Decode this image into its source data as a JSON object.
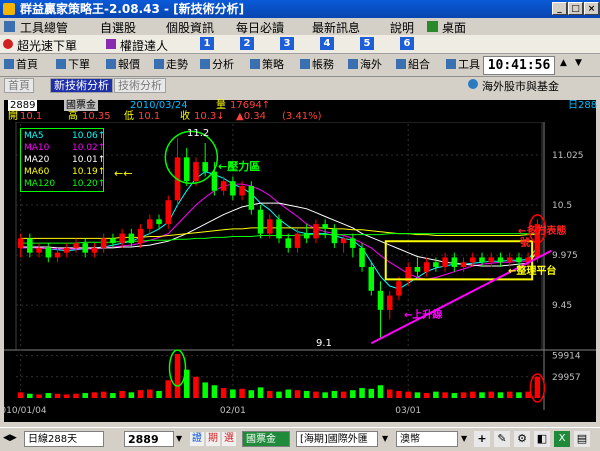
{
  "window": {
    "title": "群益贏家策略王-2.08.43 - [新技術分析]"
  },
  "menu": {
    "items": [
      "工具總管",
      "自選股",
      "個股資訊",
      "每日必讀",
      "最新訊息",
      "說明",
      "桌面"
    ]
  },
  "quickbar": {
    "items": [
      "超光速下單",
      "權證達人"
    ],
    "numbers": [
      "1",
      "2",
      "3",
      "4",
      "5",
      "6"
    ]
  },
  "toolbar": {
    "items": [
      "首頁",
      "下單",
      "報價",
      "走勢",
      "分析",
      "策略",
      "帳務",
      "海外",
      "組合",
      "工具"
    ],
    "clock": "10:41:56"
  },
  "tabs": {
    "items": [
      "首頁",
      "新技術分析",
      "技術分析"
    ],
    "right_link": "海外股市與基金"
  },
  "info": {
    "code": "2889",
    "name": "國票金",
    "date": "2010/03/24",
    "volume_label": "量",
    "volume": "17694↑",
    "open_label": "開",
    "open": "10.1",
    "high_label": "高",
    "high": "10.35",
    "low_label": "低",
    "low": "10.1",
    "close_label": "收",
    "close": "10.3↓",
    "change": "▲0.34",
    "change_pct": "(3.41%)",
    "right_label": "日288"
  },
  "ma_legend": [
    {
      "name": "MA5",
      "value": "10.06↑",
      "color": "#00ffff"
    },
    {
      "name": "MA10",
      "value": "10.02↑",
      "color": "#ff00ff"
    },
    {
      "name": "MA20",
      "value": "10.01↑",
      "color": "#ffffff"
    },
    {
      "name": "MA60",
      "value": "10.19↑",
      "color": "#ffff00"
    },
    {
      "name": "MA120",
      "value": "10.20↑",
      "color": "#00ff00"
    }
  ],
  "annotations": {
    "resistance": "←壓力區",
    "bull_pattern": "←多方表態",
    "bull_pattern_tail": "號",
    "consolidation": "←整理平台",
    "uptrend": "←上升線",
    "left_arrow": "←←",
    "peak_label": "11.2",
    "low_label": "9.1"
  },
  "chart_data": {
    "type": "candlestick",
    "price_axis_ticks": [
      "11.025",
      "10.5",
      "9.975",
      "9.45"
    ],
    "volume_axis_ticks": [
      "59914",
      "29957"
    ],
    "x_ticks": [
      "2010/01/04",
      "02/01",
      "03/01"
    ],
    "ylim": [
      9.0,
      11.35
    ],
    "candles": [
      {
        "o": 10.05,
        "c": 10.15,
        "h": 10.2,
        "l": 9.95
      },
      {
        "o": 10.15,
        "c": 10.0,
        "h": 10.2,
        "l": 9.95
      },
      {
        "o": 10.0,
        "c": 10.05,
        "h": 10.1,
        "l": 9.95
      },
      {
        "o": 10.05,
        "c": 9.95,
        "h": 10.1,
        "l": 9.9
      },
      {
        "o": 9.95,
        "c": 10.0,
        "h": 10.05,
        "l": 9.9
      },
      {
        "o": 10.0,
        "c": 10.05,
        "h": 10.1,
        "l": 9.95
      },
      {
        "o": 10.05,
        "c": 10.1,
        "h": 10.15,
        "l": 10.0
      },
      {
        "o": 10.1,
        "c": 10.0,
        "h": 10.15,
        "l": 9.95
      },
      {
        "o": 10.0,
        "c": 10.05,
        "h": 10.1,
        "l": 9.95
      },
      {
        "o": 10.05,
        "c": 10.15,
        "h": 10.2,
        "l": 10.0
      },
      {
        "o": 10.15,
        "c": 10.1,
        "h": 10.2,
        "l": 10.05
      },
      {
        "o": 10.1,
        "c": 10.2,
        "h": 10.25,
        "l": 10.05
      },
      {
        "o": 10.2,
        "c": 10.1,
        "h": 10.25,
        "l": 10.05
      },
      {
        "o": 10.1,
        "c": 10.25,
        "h": 10.3,
        "l": 10.05
      },
      {
        "o": 10.25,
        "c": 10.35,
        "h": 10.4,
        "l": 10.2
      },
      {
        "o": 10.35,
        "c": 10.3,
        "h": 10.4,
        "l": 10.25
      },
      {
        "o": 10.3,
        "c": 10.55,
        "h": 10.6,
        "l": 10.25
      },
      {
        "o": 10.55,
        "c": 11.0,
        "h": 11.2,
        "l": 10.5
      },
      {
        "o": 11.0,
        "c": 10.75,
        "h": 11.1,
        "l": 10.7
      },
      {
        "o": 10.75,
        "c": 10.95,
        "h": 11.0,
        "l": 10.7
      },
      {
        "o": 10.95,
        "c": 10.85,
        "h": 11.15,
        "l": 10.8
      },
      {
        "o": 10.85,
        "c": 10.65,
        "h": 10.95,
        "l": 10.6
      },
      {
        "o": 10.65,
        "c": 10.75,
        "h": 10.8,
        "l": 10.6
      },
      {
        "o": 10.75,
        "c": 10.6,
        "h": 10.8,
        "l": 10.55
      },
      {
        "o": 10.6,
        "c": 10.7,
        "h": 10.75,
        "l": 10.55
      },
      {
        "o": 10.7,
        "c": 10.45,
        "h": 10.75,
        "l": 10.4
      },
      {
        "o": 10.45,
        "c": 10.2,
        "h": 10.5,
        "l": 10.15
      },
      {
        "o": 10.2,
        "c": 10.35,
        "h": 10.4,
        "l": 10.15
      },
      {
        "o": 10.35,
        "c": 10.15,
        "h": 10.4,
        "l": 10.1
      },
      {
        "o": 10.15,
        "c": 10.05,
        "h": 10.2,
        "l": 10.0
      },
      {
        "o": 10.05,
        "c": 10.2,
        "h": 10.25,
        "l": 10.0
      },
      {
        "o": 10.2,
        "c": 10.15,
        "h": 10.3,
        "l": 10.1
      },
      {
        "o": 10.15,
        "c": 10.3,
        "h": 10.35,
        "l": 10.1
      },
      {
        "o": 10.3,
        "c": 10.25,
        "h": 10.35,
        "l": 10.15
      },
      {
        "o": 10.25,
        "c": 10.1,
        "h": 10.3,
        "l": 10.05
      },
      {
        "o": 10.1,
        "c": 10.15,
        "h": 10.2,
        "l": 10.0
      },
      {
        "o": 10.15,
        "c": 10.05,
        "h": 10.2,
        "l": 9.95
      },
      {
        "o": 10.05,
        "c": 9.85,
        "h": 10.1,
        "l": 9.8
      },
      {
        "o": 9.85,
        "c": 9.6,
        "h": 9.9,
        "l": 9.55
      },
      {
        "o": 9.6,
        "c": 9.4,
        "h": 9.7,
        "l": 9.1
      },
      {
        "o": 9.4,
        "c": 9.55,
        "h": 9.6,
        "l": 9.3
      },
      {
        "o": 9.55,
        "c": 9.7,
        "h": 9.75,
        "l": 9.5
      },
      {
        "o": 9.7,
        "c": 9.85,
        "h": 9.9,
        "l": 9.65
      },
      {
        "o": 9.85,
        "c": 9.8,
        "h": 9.95,
        "l": 9.75
      },
      {
        "o": 9.8,
        "c": 9.9,
        "h": 9.95,
        "l": 9.75
      },
      {
        "o": 9.9,
        "c": 9.85,
        "h": 9.95,
        "l": 9.8
      },
      {
        "o": 9.85,
        "c": 9.95,
        "h": 10.0,
        "l": 9.8
      },
      {
        "o": 9.95,
        "c": 9.85,
        "h": 10.0,
        "l": 9.8
      },
      {
        "o": 9.85,
        "c": 9.9,
        "h": 9.95,
        "l": 9.8
      },
      {
        "o": 9.9,
        "c": 9.95,
        "h": 10.0,
        "l": 9.85
      },
      {
        "o": 9.95,
        "c": 9.9,
        "h": 10.0,
        "l": 9.85
      },
      {
        "o": 9.9,
        "c": 9.95,
        "h": 10.0,
        "l": 9.85
      },
      {
        "o": 9.95,
        "c": 9.9,
        "h": 10.0,
        "l": 9.85
      },
      {
        "o": 9.9,
        "c": 9.95,
        "h": 10.0,
        "l": 9.85
      },
      {
        "o": 9.95,
        "c": 9.9,
        "h": 10.0,
        "l": 9.85
      },
      {
        "o": 9.9,
        "c": 9.95,
        "h": 10.0,
        "l": 9.85
      },
      {
        "o": 9.95,
        "c": 10.3,
        "h": 10.35,
        "l": 9.9
      }
    ],
    "volumes": [
      8,
      6,
      5,
      7,
      6,
      5,
      6,
      7,
      8,
      9,
      7,
      10,
      8,
      11,
      12,
      10,
      25,
      62,
      40,
      30,
      22,
      18,
      14,
      12,
      13,
      11,
      15,
      10,
      9,
      12,
      11,
      10,
      9,
      8,
      10,
      9,
      11,
      14,
      13,
      18,
      12,
      10,
      9,
      8,
      7,
      9,
      8,
      7,
      8,
      9,
      8,
      9,
      8,
      9,
      8,
      9,
      30
    ],
    "volume_max": 65000,
    "ma_lines": {
      "MA5": [
        10.05,
        10.06,
        10.05,
        10.04,
        10.03,
        10.02,
        10.03,
        10.04,
        10.05,
        10.06,
        10.08,
        10.1,
        10.12,
        10.16,
        10.2,
        10.25,
        10.32,
        10.5,
        10.65,
        10.78,
        10.85,
        10.82,
        10.78,
        10.72,
        10.68,
        10.62,
        10.52,
        10.45,
        10.35,
        10.28,
        10.22,
        10.2,
        10.2,
        10.2,
        10.18,
        10.15,
        10.13,
        10.05,
        9.9,
        9.75,
        9.65,
        9.62,
        9.68,
        9.74,
        9.8,
        9.84,
        9.86,
        9.88,
        9.88,
        9.89,
        9.9,
        9.91,
        9.91,
        9.92,
        9.92,
        9.93,
        10.06
      ],
      "MA10": [
        10.05,
        10.05,
        10.05,
        10.04,
        10.04,
        10.04,
        10.04,
        10.04,
        10.04,
        10.05,
        10.06,
        10.07,
        10.08,
        10.1,
        10.13,
        10.16,
        10.2,
        10.3,
        10.4,
        10.5,
        10.58,
        10.65,
        10.7,
        10.72,
        10.72,
        10.7,
        10.66,
        10.6,
        10.52,
        10.45,
        10.38,
        10.3,
        10.25,
        10.22,
        10.2,
        10.18,
        10.15,
        10.1,
        10.05,
        9.97,
        9.9,
        9.84,
        9.78,
        9.74,
        9.72,
        9.74,
        9.77,
        9.8,
        9.83,
        9.86,
        9.88,
        9.89,
        9.9,
        9.9,
        9.91,
        9.91,
        10.02
      ],
      "MA20": [
        10.06,
        10.06,
        10.06,
        10.06,
        10.05,
        10.05,
        10.05,
        10.05,
        10.05,
        10.05,
        10.05,
        10.06,
        10.06,
        10.07,
        10.08,
        10.1,
        10.12,
        10.16,
        10.2,
        10.25,
        10.3,
        10.35,
        10.4,
        10.44,
        10.48,
        10.5,
        10.52,
        10.52,
        10.52,
        10.5,
        10.48,
        10.46,
        10.42,
        10.38,
        10.34,
        10.3,
        10.26,
        10.2,
        10.16,
        10.12,
        10.08,
        10.04,
        10.0,
        9.96,
        9.94,
        9.92,
        9.9,
        9.89,
        9.88,
        9.87,
        9.86,
        9.86,
        9.86,
        9.87,
        9.88,
        9.89,
        10.01
      ],
      "MA60": [
        10.15,
        10.15,
        10.15,
        10.15,
        10.15,
        10.15,
        10.15,
        10.15,
        10.15,
        10.15,
        10.15,
        10.16,
        10.16,
        10.16,
        10.17,
        10.17,
        10.18,
        10.19,
        10.2,
        10.21,
        10.22,
        10.23,
        10.24,
        10.25,
        10.25,
        10.26,
        10.26,
        10.26,
        10.26,
        10.26,
        10.26,
        10.26,
        10.26,
        10.26,
        10.25,
        10.25,
        10.24,
        10.24,
        10.23,
        10.22,
        10.21,
        10.2,
        10.2,
        10.19,
        10.19,
        10.18,
        10.18,
        10.18,
        10.18,
        10.18,
        10.18,
        10.18,
        10.18,
        10.18,
        10.18,
        10.19,
        10.19
      ],
      "MA120": [
        10.1,
        10.1,
        10.1,
        10.1,
        10.1,
        10.1,
        10.1,
        10.11,
        10.11,
        10.11,
        10.11,
        10.12,
        10.12,
        10.12,
        10.13,
        10.13,
        10.13,
        10.14,
        10.14,
        10.15,
        10.15,
        10.16,
        10.16,
        10.17,
        10.17,
        10.17,
        10.18,
        10.18,
        10.18,
        10.18,
        10.18,
        10.19,
        10.19,
        10.19,
        10.19,
        10.19,
        10.19,
        10.19,
        10.19,
        10.19,
        10.2,
        10.2,
        10.2,
        10.2,
        10.2,
        10.2,
        10.2,
        10.2,
        10.2,
        10.2,
        10.2,
        10.2,
        10.2,
        10.2,
        10.2,
        10.2,
        10.2
      ]
    }
  },
  "bottombar": {
    "period": "日線288天",
    "code": "2889",
    "btn_a": "證",
    "btn_b": "期",
    "btn_c": "選",
    "name": "國票金",
    "market": "[海期]國際外匯",
    "currency": "澳幣"
  },
  "colors": {
    "up": "#ff0000",
    "down": "#00ff00",
    "accent": "#1e5fd8"
  }
}
